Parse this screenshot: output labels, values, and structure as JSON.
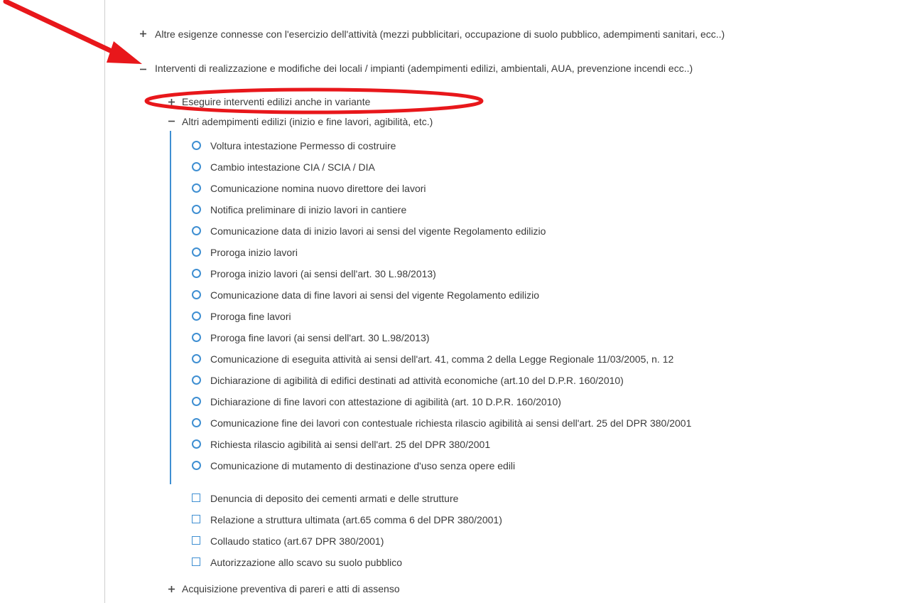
{
  "tree": {
    "level1": [
      {
        "toggle": "+",
        "label": "Altre esigenze connesse con l'esercizio dell'attività (mezzi pubblicitari, occupazione di suolo pubblico, adempimenti sanitari, ecc..)"
      },
      {
        "toggle": "−",
        "label": "Interventi di realizzazione e modifiche dei locali / impianti (adempimenti edilizi, ambientali, AUA, prevenzione incendi ecc..)"
      }
    ],
    "level2": [
      {
        "toggle": "+",
        "label": "Eseguire interventi edilizi anche in variante"
      },
      {
        "toggle": "−",
        "label": "Altri adempimenti edilizi (inizio e fine lavori, agibilità, etc.)"
      }
    ],
    "circle_items": [
      "Voltura intestazione Permesso di costruire",
      "Cambio intestazione CIA / SCIA / DIA",
      "Comunicazione nomina nuovo direttore dei lavori",
      "Notifica preliminare di inizio lavori in cantiere",
      "Comunicazione data di inizio lavori ai sensi del vigente Regolamento edilizio",
      "Proroga inizio lavori",
      "Proroga inizio lavori (ai sensi dell'art. 30 L.98/2013)",
      "Comunicazione data di fine lavori ai sensi del vigente Regolamento edilizio",
      "Proroga fine lavori",
      "Proroga fine lavori (ai sensi dell'art. 30 L.98/2013)",
      "Comunicazione di eseguita attività ai sensi dell'art. 41, comma 2 della Legge Regionale 11/03/2005, n. 12",
      "Dichiarazione di agibilità di edifici destinati ad attività economiche (art.10 del D.P.R. 160/2010)",
      "Dichiarazione di fine lavori con attestazione di agibilità (art. 10 D.P.R. 160/2010)",
      "Comunicazione fine dei lavori con contestuale richiesta rilascio agibilità ai sensi dell'art. 25 del DPR 380/2001",
      "Richiesta rilascio agibilità ai sensi dell'art. 25 del DPR 380/2001",
      "Comunicazione di mutamento di destinazione d'uso senza opere edili"
    ],
    "square_items": [
      "Denuncia di deposito dei cementi armati e delle strutture",
      "Relazione a struttura ultimata (art.65 comma 6 del DPR 380/2001)",
      "Collaudo statico (art.67 DPR 380/2001)",
      "Autorizzazione allo scavo su suolo pubblico"
    ],
    "bottom_items": [
      {
        "toggle": "+",
        "label": "Acquisizione preventiva di pareri e atti di assenso"
      }
    ]
  },
  "colors": {
    "accent": "#3f8fd2",
    "annotation": "#e8171b",
    "text": "#3a3a3a"
  }
}
